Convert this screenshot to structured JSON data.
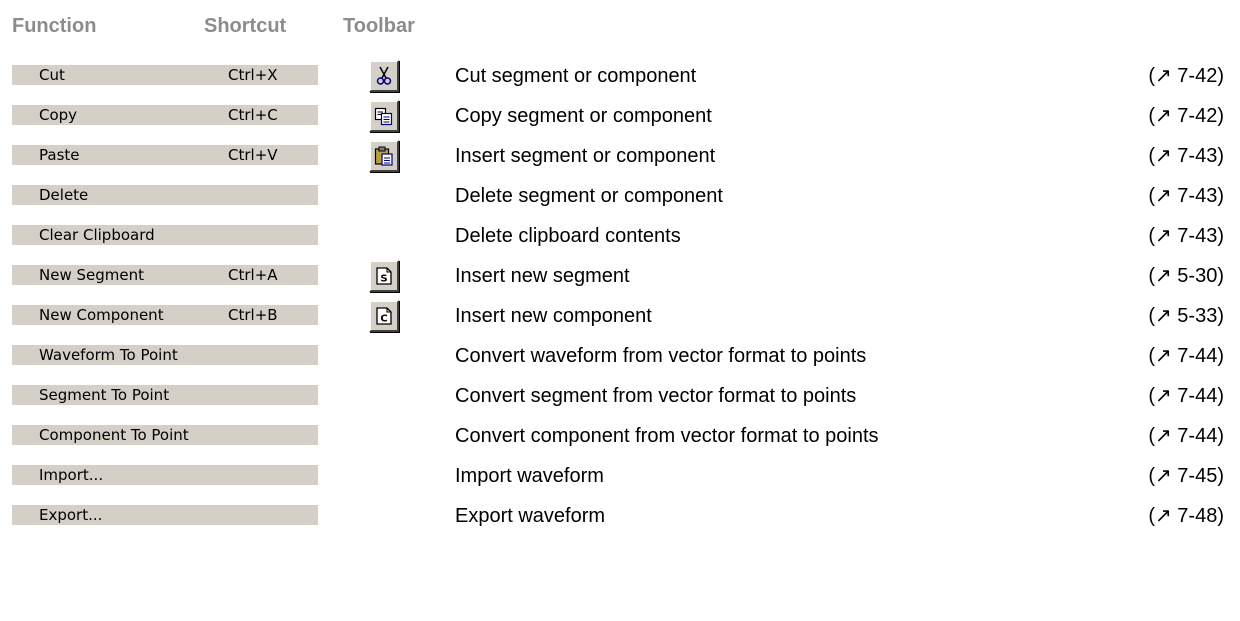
{
  "headers": {
    "function": "Function",
    "shortcut": "Shortcut",
    "toolbar": "Toolbar"
  },
  "colors": {
    "header_text": "#8c8c8c",
    "menu_bg": "#d4d0c8"
  },
  "rows": [
    {
      "label": "Cut",
      "shortcut": "Ctrl+X",
      "icon": "scissors-icon",
      "description": "Cut segment or component",
      "ref": "(↗ 7-42)"
    },
    {
      "label": "Copy",
      "shortcut": "Ctrl+C",
      "icon": "copy-icon",
      "description": "Copy segment or component",
      "ref": "(↗ 7-42)"
    },
    {
      "label": "Paste",
      "shortcut": "Ctrl+V",
      "icon": "paste-icon",
      "description": "Insert segment or component",
      "ref": "(↗ 7-43)"
    },
    {
      "label": "Delete",
      "shortcut": "",
      "icon": "",
      "description": "Delete segment or component",
      "ref": "(↗ 7-43)"
    },
    {
      "label": "Clear Clipboard",
      "shortcut": "",
      "icon": "",
      "description": "Delete clipboard contents",
      "ref": "(↗ 7-43)"
    },
    {
      "label": "New Segment",
      "shortcut": "Ctrl+A",
      "icon": "new-segment-icon",
      "description": "Insert new segment",
      "ref": "(↗ 5-30)"
    },
    {
      "label": "New Component",
      "shortcut": "Ctrl+B",
      "icon": "new-component-icon",
      "description": "Insert new component",
      "ref": "(↗ 5-33)"
    },
    {
      "label": "Waveform To Point",
      "shortcut": "",
      "icon": "",
      "description": "Convert waveform from vector format to points",
      "ref": "(↗ 7-44)"
    },
    {
      "label": "Segment To Point",
      "shortcut": "",
      "icon": "",
      "description": "Convert segment from vector format to points",
      "ref": "(↗ 7-44)"
    },
    {
      "label": "Component To Point",
      "shortcut": "",
      "icon": "",
      "description": "Convert component from vector format to points",
      "ref": "(↗ 7-44)"
    },
    {
      "label": "Import...",
      "shortcut": "",
      "icon": "",
      "description": "Import waveform",
      "ref": "(↗ 7-45)"
    },
    {
      "label": "Export...",
      "shortcut": "",
      "icon": "",
      "description": "Export waveform",
      "ref": "(↗ 7-48)"
    }
  ]
}
